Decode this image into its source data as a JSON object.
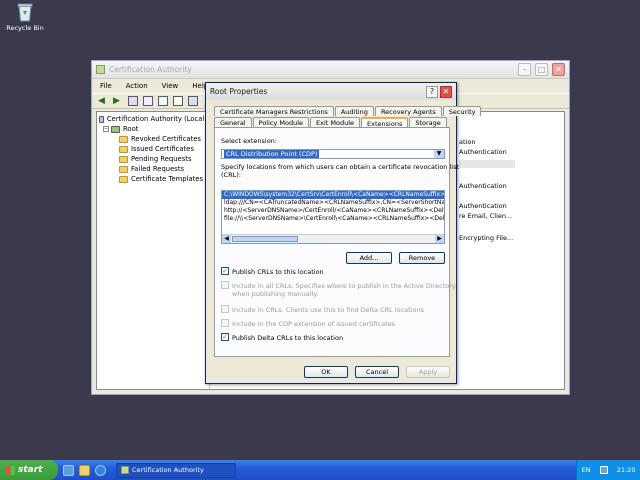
{
  "desktop": {
    "recycle_bin_label": "Recycle Bin"
  },
  "mmc": {
    "title": "Certification Authority",
    "menu": [
      "File",
      "Action",
      "View",
      "Help"
    ],
    "tree": {
      "root_label": "Certification Authority (Local)",
      "ca_label": "Root",
      "children": [
        "Revoked Certificates",
        "Issued Certificates",
        "Pending Requests",
        "Failed Requests",
        "Certificate Templates"
      ]
    },
    "right_fragments": [
      "ation",
      "Authentication",
      "Authentication",
      "Authentication",
      "re Email, Clien...",
      "Encrypting File..."
    ]
  },
  "dialog": {
    "title": "Root Properties",
    "help_glyph": "?",
    "close_glyph": "✕",
    "tabs_row1": [
      "Certificate Managers Restrictions",
      "Auditing",
      "Recovery Agents",
      "Security"
    ],
    "tabs_row2": [
      "General",
      "Policy Module",
      "Exit Module",
      "Extensions",
      "Storage"
    ],
    "active_tab": "Extensions",
    "select_extension_label": "Select extension:",
    "select_extension_value": "CRL Distribution Point (CDP)",
    "specify_text_line1": "Specify locations from which users can obtain a certificate revocation list",
    "specify_text_line2": "(CRL):",
    "urls": [
      "C:\\WINDOWS\\system32\\CertSrv\\CertEnroll\\<CaName><CRLNameSuffix>",
      "ldap:///CN=<CATruncatedName><CRLNameSuffix>,CN=<ServerShortNam",
      "http://<ServerDNSName>/CertEnroll/<CaName><CRLNameSuffix><Delta",
      "file://\\\\<ServerDNSName>\\CertEnroll\\<CaName><CRLNameSuffix><Delt"
    ],
    "add_button": "Add...",
    "remove_button": "Remove",
    "checkboxes": [
      {
        "label": "Publish CRLs to this location",
        "checked": true,
        "enabled": true
      },
      {
        "label": "Include in all CRLs. Specifies where to publish in the Active Directory",
        "label2": "when publishing manually.",
        "checked": false,
        "enabled": false
      },
      {
        "label": "Include in CRLs. Clients use this to find Delta CRL locations",
        "checked": false,
        "enabled": false
      },
      {
        "label": "Include in the CDP extension of issued certificates",
        "checked": false,
        "enabled": false
      },
      {
        "label": "Publish Delta CRLs to this location",
        "checked": true,
        "enabled": true
      }
    ],
    "ok_button": "OK",
    "cancel_button": "Cancel",
    "apply_button": "Apply"
  },
  "taskbar": {
    "start_label": "start",
    "task_label": "Certification Authority",
    "lang": "EN",
    "clock": "21:20"
  }
}
